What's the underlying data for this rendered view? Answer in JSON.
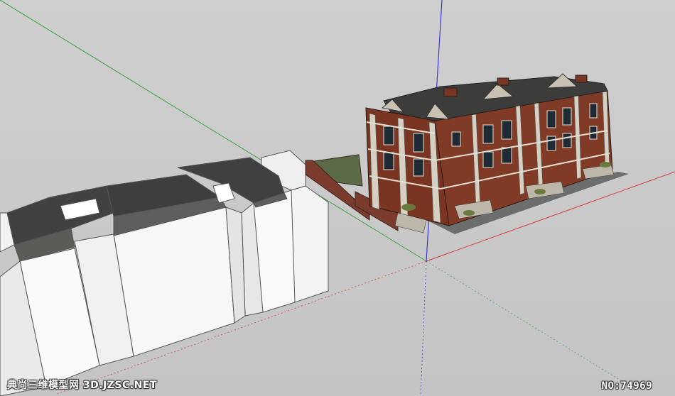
{
  "viewport": {
    "background": "#c9c9c9",
    "axis_colors": {
      "red": "#d93a3a",
      "green": "#3aa23a",
      "blue": "#3a3ad9"
    }
  },
  "scene": {
    "model_left": "white massing model with dark grey shingle roofs",
    "model_right": "red brick townhouse row with stone trim"
  },
  "watermark": {
    "left": "典尚三维模型网 3D.JZSC.NET",
    "right": "NO:74969"
  }
}
